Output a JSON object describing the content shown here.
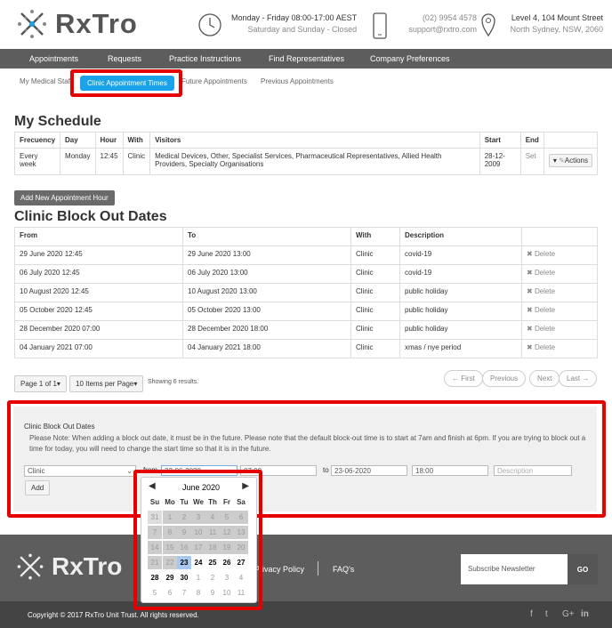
{
  "brand": {
    "name": "RxTro"
  },
  "header": {
    "hours_line1": "Monday - Friday 08:00-17:00 AEST",
    "hours_line2": "Saturday and Sunday - Closed",
    "phone": "(02) 9954 4578",
    "email": "support@rxtro.com",
    "addr1": "Level 4, 104 Mount Street",
    "addr2": "North Sydney, NSW, 2060"
  },
  "nav": [
    "Appointments",
    "Requests",
    "Practice Instructions",
    "Find Representatives",
    "Company Preferences"
  ],
  "subnav": [
    "My Medical Staff",
    "Clinic Appointment Times",
    "Future Appointments",
    "Previous Appointments"
  ],
  "schedule": {
    "title": "My Schedule",
    "headers": [
      "Frecuency",
      "Day",
      "Hour",
      "With",
      "Visitors",
      "Start",
      "End",
      ""
    ],
    "row": [
      "Every week",
      "Monday",
      "12:45",
      "Clinic",
      "Medical Devices, Other, Specialist Services, Pharmaceutical Representatives, Allied Health Providers, Specialty Organisations",
      "28-12-2009",
      "Set"
    ],
    "actions": "Actions",
    "add_button": "Add New Appointment Hour"
  },
  "blockout": {
    "title": "Clinic Block Out Dates",
    "headers": [
      "From",
      "To",
      "With",
      "Description",
      ""
    ],
    "delete_label": "Delete",
    "rows": [
      [
        "29 June 2020 12:45",
        "29 June 2020 13:00",
        "Clinic",
        "covid-19"
      ],
      [
        "06 July 2020 12:45",
        "06 July 2020 13:00",
        "Clinic",
        "covid-19"
      ],
      [
        "10 August 2020 12:45",
        "10 August 2020 13:00",
        "Clinic",
        "public holiday"
      ],
      [
        "05 October 2020 12:45",
        "05 October 2020 13:00",
        "Clinic",
        "public holiday"
      ],
      [
        "28 December 2020 07:00",
        "28 December 2020 18:00",
        "Clinic",
        "public holiday"
      ],
      [
        "04 January 2021 07:00",
        "04 January 2021 18:00",
        "Clinic",
        "xmas / nye period"
      ]
    ]
  },
  "pager": {
    "page": "Page 1 of 1",
    "per_page": "10 Items per Page",
    "showing": "Showing 6 results.",
    "first": "← First",
    "prev": "Previous",
    "next": "Next",
    "last": "Last →"
  },
  "form": {
    "title": "Clinic Block Out Dates",
    "note": "Please Note: When adding a block out date, it must be in the future. Please note that the default block-out time is to start at 7am and finish at 6pm. If you are trying to block out a time for today, you will need to change the start time so that it is in the future.",
    "select": "Clinic",
    "from_label": "from",
    "from_date": "23-06-2020",
    "from_time": "07:00",
    "to_label": "to",
    "to_date": "23-06-2020",
    "to_time": "18:00",
    "desc_placeholder": "Description",
    "add": "Add"
  },
  "calendar": {
    "month": "June 2020",
    "weekdays": [
      "Su",
      "Mo",
      "Tu",
      "We",
      "Th",
      "Fr",
      "Sa"
    ],
    "weeks": [
      [
        "31",
        "1",
        "2",
        "3",
        "4",
        "5",
        "6"
      ],
      [
        "7",
        "8",
        "9",
        "10",
        "11",
        "12",
        "13"
      ],
      [
        "14",
        "15",
        "16",
        "17",
        "18",
        "19",
        "20"
      ],
      [
        "21",
        "22",
        "23",
        "24",
        "25",
        "26",
        "27"
      ],
      [
        "28",
        "29",
        "30",
        "1",
        "2",
        "3",
        "4"
      ],
      [
        "5",
        "6",
        "7",
        "8",
        "9",
        "10",
        "11"
      ]
    ],
    "today": "23"
  },
  "footer": {
    "privacy": "Privacy Policy",
    "faq": "FAQ's",
    "newsletter_placeholder": "Subscribe Newsletter",
    "go": "GO",
    "copyright": "Copyright © 2017 RxTro Unit Trust. All rights reserved.",
    "social": [
      "f",
      "t",
      "G+",
      "in"
    ]
  }
}
